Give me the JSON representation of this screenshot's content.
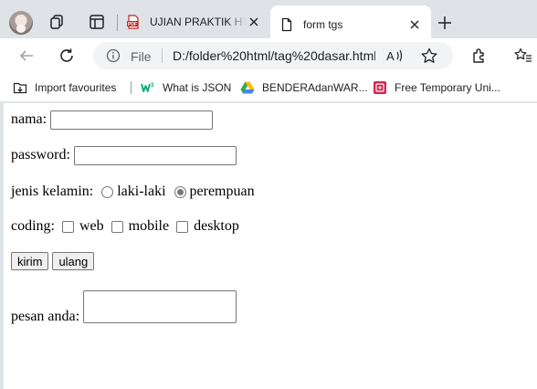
{
  "browser": {
    "tabs": [
      {
        "title": "UJIAN PRAKTIK HTML",
        "favicon": "pdf-icon",
        "active": false
      },
      {
        "title": "form tgs",
        "favicon": "document-icon",
        "active": true
      }
    ],
    "address_bar": {
      "scheme_label": "File",
      "url": "D:/folder%20html/tag%20dasar.html"
    },
    "favourites": [
      {
        "label": "Import favourites",
        "icon": "import-icon"
      },
      {
        "label": "What is JSON",
        "icon": "w3-icon"
      },
      {
        "label": "BENDERAdanWAR...",
        "icon": "google-drive-icon"
      },
      {
        "label": "Free Temporary Uni...",
        "icon": "temp-mail-icon"
      }
    ]
  },
  "form": {
    "nama_label": "nama:",
    "nama_value": "",
    "password_label": "password:",
    "password_value": "",
    "gender_label": "jenis kelamin:",
    "gender_options": [
      "laki-laki",
      "perempuan"
    ],
    "gender_selected": "perempuan",
    "coding_label": "coding:",
    "coding_options": [
      "web",
      "mobile",
      "desktop"
    ],
    "submit_label": "kirim",
    "reset_label": "ulang",
    "message_label": "pesan anda:",
    "message_value": ""
  }
}
